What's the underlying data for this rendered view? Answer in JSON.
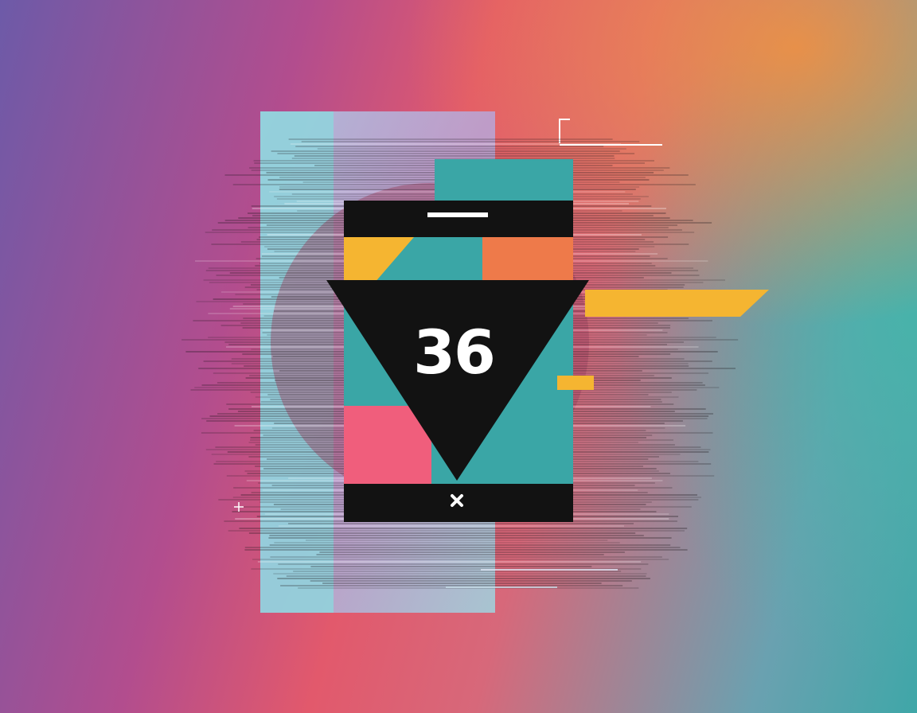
{
  "artwork": {
    "number_text": "36",
    "icons": [
      "close-icon",
      "sparkle-icon"
    ],
    "palette": {
      "accent_black": "#121212",
      "teal": "#3aa6a6",
      "coral": "#ee7a4a",
      "yellow": "#f5b531",
      "pink": "#f05e7c",
      "light_cyan": "#8fd3dc"
    }
  }
}
